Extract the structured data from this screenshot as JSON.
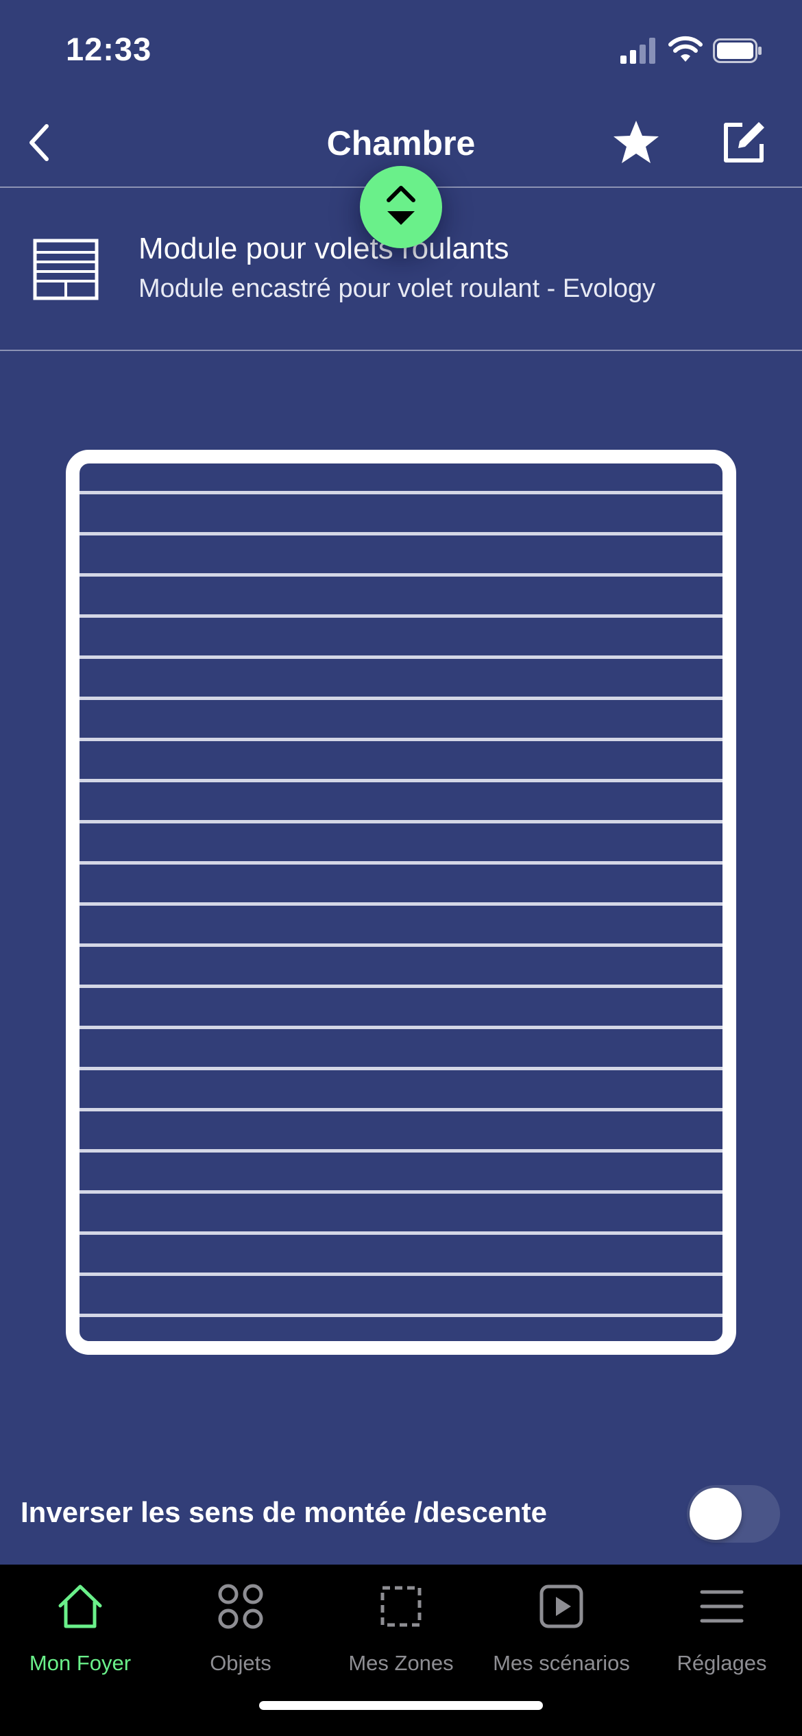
{
  "status_bar": {
    "time": "12:33"
  },
  "header": {
    "title": "Chambre"
  },
  "device": {
    "name": "Module pour volets roulants",
    "description": "Module encastré pour volet roulant - Evology"
  },
  "settings": {
    "invert_label": "Inverser les sens de montée /descente",
    "invert_enabled": false
  },
  "tabs": [
    {
      "label": "Mon Foyer",
      "icon": "house-icon",
      "active": true
    },
    {
      "label": "Objets",
      "icon": "circles-grid-icon",
      "active": false
    },
    {
      "label": "Mes Zones",
      "icon": "dashed-square-icon",
      "active": false
    },
    {
      "label": "Mes scénarios",
      "icon": "play-square-icon",
      "active": false
    },
    {
      "label": "Réglages",
      "icon": "menu-icon",
      "active": false
    }
  ],
  "colors": {
    "background": "#323e78",
    "accent": "#6af08a",
    "tabbar": "#000000",
    "inactive_tab": "#8e8e93"
  }
}
